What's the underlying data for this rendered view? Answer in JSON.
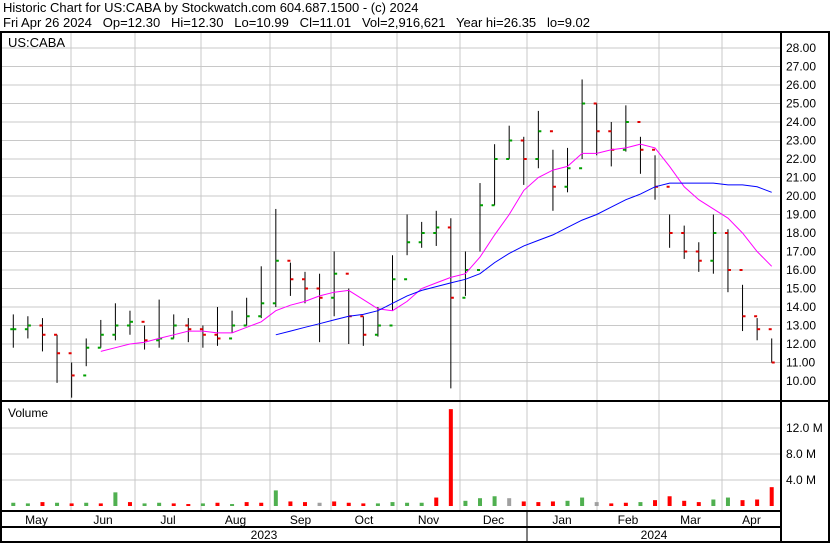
{
  "header": {
    "line1": "Historic Chart for US:CABA by Stockwatch.com 604.687.1500 - (c) 2024",
    "line2": "Fri Apr 26 2024   Op=12.30   Hi=12.30   Lo=10.99   Cl=11.01   Vol=2,916,621   Year hi=26.35   lo=9.02"
  },
  "colors": {
    "up": "#00a000",
    "down": "#e00000",
    "ma50": "#ff00ff",
    "ma200": "#0000ff",
    "grid": "#c8c8c8",
    "vol_up": "#50b050",
    "vol_down": "#ff0000",
    "vol_flat": "#a0a0a0"
  },
  "chart_data": {
    "type": "ohlc",
    "symbol_label": "US:CABA",
    "volume_label": "Volume",
    "price_ticks": [
      "28.00",
      "27.00",
      "26.00",
      "25.00",
      "24.00",
      "23.00",
      "22.00",
      "21.00",
      "20.00",
      "19.00",
      "18.00",
      "17.00",
      "16.00",
      "15.00",
      "14.00",
      "13.00",
      "12.00",
      "11.00",
      "10.00"
    ],
    "price_range": [
      9.1,
      28.5
    ],
    "volume_ticks": [
      "12.0 M",
      "8.0 M",
      "4.0 M"
    ],
    "volume_range_m": [
      0,
      16.5
    ],
    "months": [
      "May",
      "Jun",
      "Jul",
      "Aug",
      "Sep",
      "Oct",
      "Nov",
      "Dec",
      "Jan",
      "Feb",
      "Mar",
      "Apr"
    ],
    "years": [
      "2023",
      "2024"
    ],
    "weekly_close": [
      12.8,
      13.0,
      12.5,
      11.5,
      10.3,
      11.8,
      12.5,
      13.0,
      13.2,
      12.2,
      12.3,
      13.0,
      12.8,
      12.5,
      12.3,
      13.0,
      13.5,
      14.2,
      16.5,
      15.5,
      15.0,
      14.5,
      15.8,
      13.5,
      12.5,
      13.0,
      15.5,
      17.5,
      18.0,
      18.3,
      14.5,
      16.0,
      19.5,
      22.0,
      23.0,
      22.0,
      23.5,
      20.5,
      21.5,
      25.0,
      23.5,
      22.5,
      24.0,
      22.5,
      20.5,
      18.0,
      17.0,
      16.5,
      18.0,
      16.0,
      13.5,
      12.8,
      11.0
    ],
    "weekly_high": [
      13.6,
      13.5,
      13.4,
      12.5,
      11.0,
      12.3,
      13.3,
      14.2,
      13.8,
      13.0,
      14.4,
      13.6,
      13.4,
      13.0,
      14.0,
      13.8,
      14.5,
      16.2,
      19.3,
      16.4,
      15.9,
      15.8,
      17.0,
      15.0,
      13.5,
      14.0,
      16.8,
      19.0,
      18.6,
      19.2,
      18.8,
      17.0,
      20.7,
      22.8,
      23.8,
      23.2,
      24.6,
      22.5,
      22.6,
      26.3,
      25.0,
      24.0,
      24.9,
      23.2,
      22.2,
      19.0,
      18.4,
      17.5,
      19.0,
      18.2,
      15.2,
      13.4,
      12.3
    ],
    "weekly_low": [
      11.8,
      12.3,
      11.6,
      9.9,
      9.1,
      10.8,
      11.8,
      12.2,
      12.5,
      11.7,
      11.8,
      12.3,
      12.1,
      11.8,
      11.9,
      12.6,
      13.0,
      13.4,
      14.0,
      14.6,
      14.2,
      12.1,
      13.5,
      12.0,
      11.9,
      12.4,
      13.8,
      16.8,
      17.2,
      17.3,
      9.6,
      14.6,
      17.0,
      19.5,
      22.0,
      20.6,
      21.5,
      19.2,
      20.2,
      22.0,
      22.2,
      21.6,
      22.4,
      21.2,
      19.8,
      17.2,
      16.6,
      15.9,
      15.8,
      14.8,
      12.7,
      12.2,
      10.99
    ],
    "ma50": [
      null,
      null,
      null,
      null,
      null,
      null,
      11.6,
      11.8,
      12.0,
      12.1,
      12.3,
      12.5,
      12.7,
      12.7,
      12.6,
      12.6,
      12.9,
      13.2,
      13.8,
      14.1,
      14.3,
      14.6,
      14.8,
      14.9,
      14.4,
      13.9,
      13.8,
      14.3,
      15.0,
      15.3,
      15.6,
      15.8,
      16.7,
      17.9,
      19.0,
      20.3,
      21.0,
      21.4,
      21.6,
      22.3,
      22.3,
      22.5,
      22.6,
      22.8,
      22.6,
      21.6,
      20.5,
      19.8,
      19.3,
      18.8,
      18.0,
      17.0,
      16.2
    ],
    "ma200": [
      null,
      null,
      null,
      null,
      null,
      null,
      null,
      null,
      null,
      null,
      null,
      null,
      null,
      null,
      null,
      null,
      null,
      null,
      12.5,
      12.7,
      12.9,
      13.1,
      13.3,
      13.5,
      13.6,
      13.8,
      14.2,
      14.6,
      14.9,
      15.1,
      15.3,
      15.5,
      15.8,
      16.4,
      16.9,
      17.3,
      17.6,
      17.9,
      18.3,
      18.7,
      19.0,
      19.4,
      19.8,
      20.1,
      20.5,
      20.7,
      20.7,
      20.7,
      20.7,
      20.6,
      20.6,
      20.5,
      20.2
    ],
    "weekly_volume_m": [
      0.5,
      0.4,
      0.6,
      0.5,
      0.4,
      0.5,
      0.4,
      2.1,
      0.6,
      0.4,
      0.5,
      0.4,
      0.3,
      0.4,
      0.5,
      0.3,
      0.6,
      0.5,
      2.4,
      0.7,
      0.6,
      0.5,
      0.7,
      0.5,
      0.4,
      0.4,
      0.6,
      0.5,
      0.5,
      1.3,
      14.9,
      0.8,
      1.2,
      1.5,
      1.2,
      0.7,
      0.6,
      0.7,
      0.8,
      1.3,
      0.6,
      0.4,
      0.5,
      0.6,
      0.9,
      1.5,
      0.8,
      0.6,
      1.0,
      1.3,
      0.9,
      1.0,
      2.9
    ],
    "weekly_volume_dir": [
      "u",
      "u",
      "d",
      "u",
      "d",
      "u",
      "d",
      "u",
      "d",
      "u",
      "u",
      "d",
      "d",
      "u",
      "d",
      "u",
      "d",
      "d",
      "u",
      "d",
      "d",
      "n",
      "d",
      "d",
      "d",
      "u",
      "u",
      "u",
      "u",
      "d",
      "d",
      "u",
      "u",
      "u",
      "n",
      "d",
      "d",
      "d",
      "u",
      "u",
      "n",
      "d",
      "d",
      "u",
      "d",
      "d",
      "d",
      "d",
      "u",
      "u",
      "d",
      "d",
      "d"
    ]
  }
}
